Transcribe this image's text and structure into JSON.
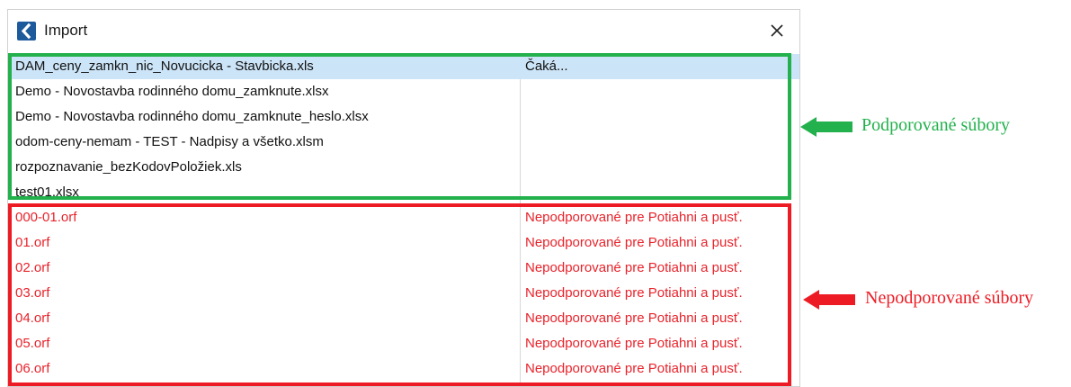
{
  "window": {
    "title": "Import",
    "icon": "back-arrow-icon",
    "close_icon": "close-icon"
  },
  "supported_files": [
    {
      "name": "DAM_ceny_zamkn_nic_Novucicka - Stavbicka.xls",
      "status": "Čaká...",
      "selected": true
    },
    {
      "name": "Demo - Novostavba rodinného domu_zamknute.xlsx",
      "status": ""
    },
    {
      "name": "Demo - Novostavba rodinného domu_zamknute_heslo.xlsx",
      "status": ""
    },
    {
      "name": "odom-ceny-nemam - TEST - Nadpisy a všetko.xlsm",
      "status": ""
    },
    {
      "name": "rozpoznavanie_bezKodovPoložiek.xls",
      "status": ""
    },
    {
      "name": "test01.xlsx",
      "status": ""
    }
  ],
  "unsupported_files": [
    {
      "name": "000-01.orf",
      "status": "Nepodporované pre Potiahni a pusť."
    },
    {
      "name": "01.orf",
      "status": "Nepodporované pre Potiahni a pusť."
    },
    {
      "name": "02.orf",
      "status": "Nepodporované pre Potiahni a pusť."
    },
    {
      "name": "03.orf",
      "status": "Nepodporované pre Potiahni a pusť."
    },
    {
      "name": "04.orf",
      "status": "Nepodporované pre Potiahni a pusť."
    },
    {
      "name": "05.orf",
      "status": "Nepodporované pre Potiahni a pusť."
    },
    {
      "name": "06.orf",
      "status": "Nepodporované pre Potiahni a pusť."
    }
  ],
  "annotations": {
    "supported_label": "Podporované súbory",
    "unsupported_label": "Nepodporované súbory"
  },
  "colors": {
    "supported": "#22b14c",
    "unsupported": "#ed1c24",
    "selected_row": "#cce4f7",
    "app_icon": "#1d5a9c"
  }
}
